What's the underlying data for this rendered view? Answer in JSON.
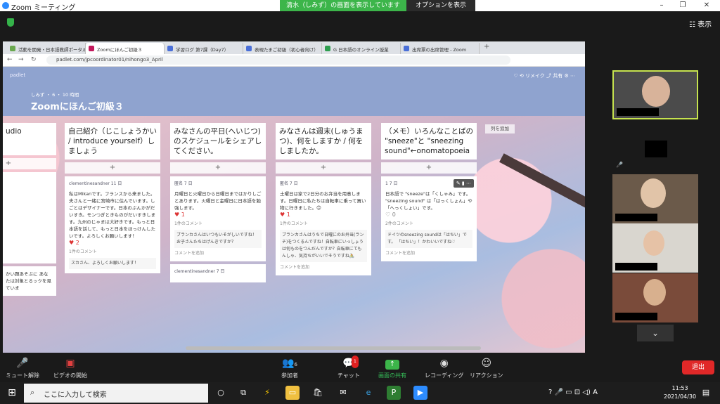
{
  "zoom": {
    "window_title": "Zoom ミーティング",
    "share_banner": "清水（しみず）の画面を表示しています",
    "options_label": "オプションを表示",
    "view_label": "表示",
    "minimize": "–",
    "restore": "❐",
    "close": "✕"
  },
  "browser": {
    "tabs": [
      {
        "label": "活動を開発・日本語教師ポータル"
      },
      {
        "label": "Zoomにほんご初級３"
      },
      {
        "label": "学習ログ 第7課（Day7）"
      },
      {
        "label": "表現たまご初級（初心者向け）"
      },
      {
        "label": "G 日本語のオンライン授業"
      },
      {
        "label": "出席票の出席管理 - Zoom"
      }
    ],
    "url": "padlet.com/jpcoordinator01/nihongo3_April",
    "back": "←",
    "forward": "→",
    "reload": "↻",
    "new_tab": "+"
  },
  "padlet": {
    "brand": "padlet",
    "meta": "しみず ・ 6 ・ 10 時間",
    "title": "Zoomにほんご初級３",
    "icons": "♡  ⟲ リメイク  ⤴ 共有  ⚙  ⋯",
    "right_chip": "列を追加",
    "add_symbol": "+",
    "columns": [
      {
        "header": "udio",
        "cards": [
          {
            "author": "",
            "text": "",
            "heart": "",
            "comments": "かい題あそぶに あなたは対象とるックを見ていま"
          }
        ]
      },
      {
        "header": "自己紹介（じこしょうかい / introduce yourself）しましょう",
        "cards": [
          {
            "author": "clementinesandner 11 日",
            "text": "私はMikanです。フランスから来ました。夫さんと一緒に宮崎市に住んでいます。しごとはデザイナーです。日本のぶんかがだいすき。モンつぎときものがだいすきします。九州のじゃまは大好きです。もっと日本語を話して、もっと日本をほっけんしたいです。よろしくお願いします！",
            "heart": "♥ 2",
            "comments": "1件のコメント",
            "comment_text": "スカさん、よろしくお願いします！"
          }
        ]
      },
      {
        "header": "みなさんの平日(へいじつ)のスケジュールをシェアしてください。",
        "cards": [
          {
            "author": "匿名 7 日",
            "text": "月曜日と火曜日から日曜日まではかりしごとあります。火曜日と金曜日に日本語を勉強します。",
            "heart": "♥ 1",
            "comments": "1件のコメント",
            "comment_text": "ブランカさんはいつもいそがしいですね！お子さんたちはげんきですか？",
            "add_comment": "コメントを追加"
          },
          {
            "author": "clementinesandner 7 日",
            "text": "",
            "heart": "",
            "comments": ""
          }
        ]
      },
      {
        "header": "みなさんは週末(しゅうまつ)、何をしますか / 何をしましたか。",
        "cards": [
          {
            "author": "匿名 7 日",
            "text": "土曜日は家で2日分のお弁当を用意します。日曜日に私たちは自転車に乗って買い物に行きました。😊",
            "heart": "♥ 1",
            "comments": "1件のコメント",
            "comment_text": "ブランカさんはうちで日曜にのお弁当(ランチ)をつくるんですね！自転車にいっしょうは何ものをつんだんですか？自転車にてもんしゃ、気持ちがいいでそうですね🚴",
            "add_comment": "コメントを追加"
          }
        ]
      },
      {
        "header": "（メモ）いろんなことばの \"sneeze\"と \"sneezing sound\"←onomatopoeia",
        "cards": [
          {
            "author": "1 7 日",
            "text": "日本語で \"sneeze\"は「くしゃみ」です。 \"sneezing sound\" は「はっくしょん」や「へっくしょい」です。",
            "heart": "♡ 0",
            "comments": "2件のコメント",
            "comment_text": "ドイツのsneezing soundは「はちい」です。 「はちい」！かわいいですね♡",
            "add_comment": "コメントを追加",
            "toolbar": "✎ ▮ ⋯"
          }
        ]
      }
    ]
  },
  "toolbar": {
    "mute": "ミュート解除",
    "video": "ビデオの開始",
    "participants": "参加者",
    "participants_count": "6",
    "chat": "チャット",
    "chat_badge": "1",
    "share": "画面の共有",
    "record": "レコーディング",
    "reactions": "リアクション",
    "end": "退出"
  },
  "taskbar": {
    "search_placeholder": "ここに入力して検索",
    "time": "11:53",
    "date": "2021/04/30",
    "ime": "A"
  },
  "colors": {
    "share_green": "#3cb54a",
    "end_red": "#e02828",
    "active_speaker_border": "#c6e34f",
    "padlet_header_bg": "#8fa3cf"
  }
}
